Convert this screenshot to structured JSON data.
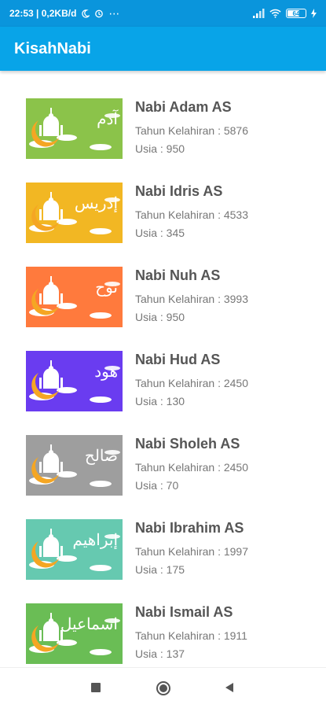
{
  "status": {
    "time_text": "22:53 | 0,2KB/d",
    "battery": "64",
    "more": "⋯"
  },
  "app": {
    "title": "KisahNabi"
  },
  "prophets": [
    {
      "name": "Nabi Adam AS",
      "birth": "Tahun Kelahiran : 5876",
      "age": "Usia : 950",
      "arabic": "آدم",
      "color": "#8bc34a"
    },
    {
      "name": "Nabi Idris AS",
      "birth": "Tahun Kelahiran : 4533",
      "age": "Usia : 345",
      "arabic": "إدريس",
      "color": "#f2b723"
    },
    {
      "name": "Nabi Nuh AS",
      "birth": "Tahun Kelahiran : 3993",
      "age": "Usia : 950",
      "arabic": "نوح",
      "color": "#ff7a3d"
    },
    {
      "name": "Nabi Hud AS",
      "birth": "Tahun Kelahiran : 2450",
      "age": "Usia : 130",
      "arabic": "هود",
      "color": "#6a3cf0"
    },
    {
      "name": "Nabi Sholeh AS",
      "birth": "Tahun Kelahiran : 2450",
      "age": "Usia : 70",
      "arabic": "صالح",
      "color": "#9e9e9e"
    },
    {
      "name": "Nabi Ibrahim AS",
      "birth": "Tahun Kelahiran : 1997",
      "age": "Usia : 175",
      "arabic": "إبراهيم",
      "color": "#66c9b0"
    },
    {
      "name": "Nabi Ismail AS",
      "birth": "Tahun Kelahiran : 1911",
      "age": "Usia : 137",
      "arabic": "اسماعيل",
      "color": "#6abd55"
    }
  ],
  "nav": {
    "recents_icon": "square-icon",
    "home_icon": "circle-icon",
    "back_icon": "triangle-icon"
  }
}
